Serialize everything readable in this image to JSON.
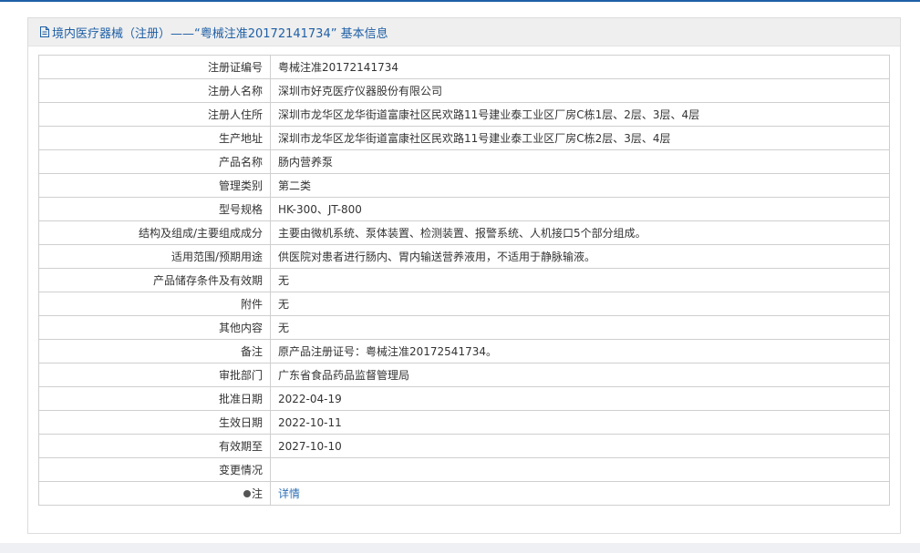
{
  "header": {
    "title": "境内医疗器械（注册）——“粤械注准20172141734” 基本信息"
  },
  "rows": [
    {
      "label": "注册证编号",
      "value": "粤械注准20172141734"
    },
    {
      "label": "注册人名称",
      "value": "深圳市好克医疗仪器股份有限公司"
    },
    {
      "label": "注册人住所",
      "value": "深圳市龙华区龙华街道富康社区民欢路11号建业泰工业区厂房C栋1层、2层、3层、4层"
    },
    {
      "label": "生产地址",
      "value": "深圳市龙华区龙华街道富康社区民欢路11号建业泰工业区厂房C栋2层、3层、4层"
    },
    {
      "label": "产品名称",
      "value": "肠内营养泵"
    },
    {
      "label": "管理类别",
      "value": "第二类"
    },
    {
      "label": "型号规格",
      "value": "HK-300、JT-800"
    },
    {
      "label": "结构及组成/主要组成成分",
      "value": "主要由微机系统、泵体装置、检测装置、报警系统、人机接口5个部分组成。"
    },
    {
      "label": "适用范围/预期用途",
      "value": "供医院对患者进行肠内、胃内输送营养液用，不适用于静脉输液。"
    },
    {
      "label": "产品储存条件及有效期",
      "value": "无"
    },
    {
      "label": "附件",
      "value": "无"
    },
    {
      "label": "其他内容",
      "value": "无"
    },
    {
      "label": "备注",
      "value": "原产品注册证号：粤械注准20172541734。"
    },
    {
      "label": "审批部门",
      "value": "广东省食品药品监督管理局"
    },
    {
      "label": "批准日期",
      "value": "2022-04-19"
    },
    {
      "label": "生效日期",
      "value": "2022-10-11"
    },
    {
      "label": "有效期至",
      "value": "2027-10-10"
    },
    {
      "label": "变更情况",
      "value": ""
    }
  ],
  "note_row": {
    "label": "注",
    "link_text": "详情",
    "icon": "info-dot-icon"
  },
  "colors": {
    "accent": "#1f5fa6",
    "link": "#2f6fb6",
    "header_bg": "#efefef",
    "border": "#cfcfcf"
  }
}
